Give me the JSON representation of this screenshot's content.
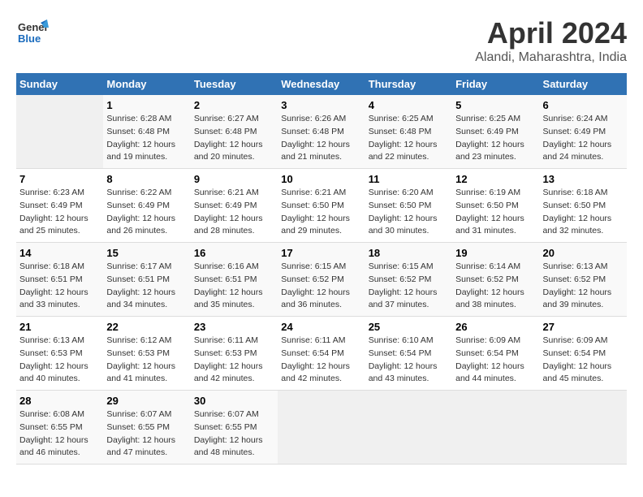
{
  "header": {
    "logo_general": "General",
    "logo_blue": "Blue",
    "title": "April 2024",
    "location": "Alandi, Maharashtra, India"
  },
  "columns": [
    "Sunday",
    "Monday",
    "Tuesday",
    "Wednesday",
    "Thursday",
    "Friday",
    "Saturday"
  ],
  "weeks": [
    {
      "days": [
        {
          "num": "",
          "info": "",
          "empty": true
        },
        {
          "num": "1",
          "info": "Sunrise: 6:28 AM\nSunset: 6:48 PM\nDaylight: 12 hours\nand 19 minutes."
        },
        {
          "num": "2",
          "info": "Sunrise: 6:27 AM\nSunset: 6:48 PM\nDaylight: 12 hours\nand 20 minutes."
        },
        {
          "num": "3",
          "info": "Sunrise: 6:26 AM\nSunset: 6:48 PM\nDaylight: 12 hours\nand 21 minutes."
        },
        {
          "num": "4",
          "info": "Sunrise: 6:25 AM\nSunset: 6:48 PM\nDaylight: 12 hours\nand 22 minutes."
        },
        {
          "num": "5",
          "info": "Sunrise: 6:25 AM\nSunset: 6:49 PM\nDaylight: 12 hours\nand 23 minutes."
        },
        {
          "num": "6",
          "info": "Sunrise: 6:24 AM\nSunset: 6:49 PM\nDaylight: 12 hours\nand 24 minutes."
        }
      ]
    },
    {
      "days": [
        {
          "num": "7",
          "info": "Sunrise: 6:23 AM\nSunset: 6:49 PM\nDaylight: 12 hours\nand 25 minutes."
        },
        {
          "num": "8",
          "info": "Sunrise: 6:22 AM\nSunset: 6:49 PM\nDaylight: 12 hours\nand 26 minutes."
        },
        {
          "num": "9",
          "info": "Sunrise: 6:21 AM\nSunset: 6:49 PM\nDaylight: 12 hours\nand 28 minutes."
        },
        {
          "num": "10",
          "info": "Sunrise: 6:21 AM\nSunset: 6:50 PM\nDaylight: 12 hours\nand 29 minutes."
        },
        {
          "num": "11",
          "info": "Sunrise: 6:20 AM\nSunset: 6:50 PM\nDaylight: 12 hours\nand 30 minutes."
        },
        {
          "num": "12",
          "info": "Sunrise: 6:19 AM\nSunset: 6:50 PM\nDaylight: 12 hours\nand 31 minutes."
        },
        {
          "num": "13",
          "info": "Sunrise: 6:18 AM\nSunset: 6:50 PM\nDaylight: 12 hours\nand 32 minutes."
        }
      ]
    },
    {
      "days": [
        {
          "num": "14",
          "info": "Sunrise: 6:18 AM\nSunset: 6:51 PM\nDaylight: 12 hours\nand 33 minutes."
        },
        {
          "num": "15",
          "info": "Sunrise: 6:17 AM\nSunset: 6:51 PM\nDaylight: 12 hours\nand 34 minutes."
        },
        {
          "num": "16",
          "info": "Sunrise: 6:16 AM\nSunset: 6:51 PM\nDaylight: 12 hours\nand 35 minutes."
        },
        {
          "num": "17",
          "info": "Sunrise: 6:15 AM\nSunset: 6:52 PM\nDaylight: 12 hours\nand 36 minutes."
        },
        {
          "num": "18",
          "info": "Sunrise: 6:15 AM\nSunset: 6:52 PM\nDaylight: 12 hours\nand 37 minutes."
        },
        {
          "num": "19",
          "info": "Sunrise: 6:14 AM\nSunset: 6:52 PM\nDaylight: 12 hours\nand 38 minutes."
        },
        {
          "num": "20",
          "info": "Sunrise: 6:13 AM\nSunset: 6:52 PM\nDaylight: 12 hours\nand 39 minutes."
        }
      ]
    },
    {
      "days": [
        {
          "num": "21",
          "info": "Sunrise: 6:13 AM\nSunset: 6:53 PM\nDaylight: 12 hours\nand 40 minutes."
        },
        {
          "num": "22",
          "info": "Sunrise: 6:12 AM\nSunset: 6:53 PM\nDaylight: 12 hours\nand 41 minutes."
        },
        {
          "num": "23",
          "info": "Sunrise: 6:11 AM\nSunset: 6:53 PM\nDaylight: 12 hours\nand 42 minutes."
        },
        {
          "num": "24",
          "info": "Sunrise: 6:11 AM\nSunset: 6:54 PM\nDaylight: 12 hours\nand 42 minutes."
        },
        {
          "num": "25",
          "info": "Sunrise: 6:10 AM\nSunset: 6:54 PM\nDaylight: 12 hours\nand 43 minutes."
        },
        {
          "num": "26",
          "info": "Sunrise: 6:09 AM\nSunset: 6:54 PM\nDaylight: 12 hours\nand 44 minutes."
        },
        {
          "num": "27",
          "info": "Sunrise: 6:09 AM\nSunset: 6:54 PM\nDaylight: 12 hours\nand 45 minutes."
        }
      ]
    },
    {
      "days": [
        {
          "num": "28",
          "info": "Sunrise: 6:08 AM\nSunset: 6:55 PM\nDaylight: 12 hours\nand 46 minutes."
        },
        {
          "num": "29",
          "info": "Sunrise: 6:07 AM\nSunset: 6:55 PM\nDaylight: 12 hours\nand 47 minutes."
        },
        {
          "num": "30",
          "info": "Sunrise: 6:07 AM\nSunset: 6:55 PM\nDaylight: 12 hours\nand 48 minutes."
        },
        {
          "num": "",
          "info": "",
          "empty": true
        },
        {
          "num": "",
          "info": "",
          "empty": true
        },
        {
          "num": "",
          "info": "",
          "empty": true
        },
        {
          "num": "",
          "info": "",
          "empty": true
        }
      ]
    }
  ]
}
